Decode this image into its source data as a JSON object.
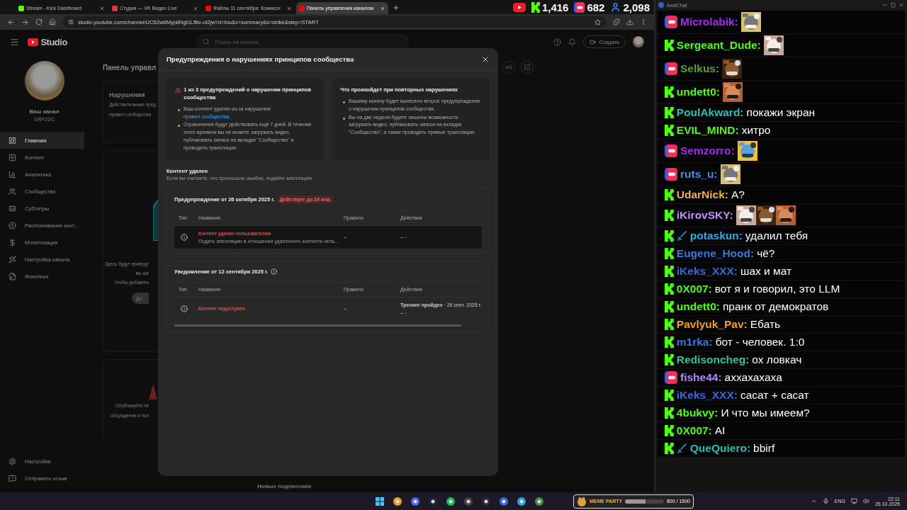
{
  "browser": {
    "tabs": [
      {
        "title": "Stream - Kick Dashboard",
        "kind": "kick",
        "selected": false
      },
      {
        "title": "Студия — VK Видео Live",
        "kind": "vk",
        "selected": false
      },
      {
        "title": "Файлы 11 сентября: Комиссн",
        "kind": "youtube",
        "selected": false
      },
      {
        "title": "Панель управления каналом",
        "kind": "youtube",
        "selected": true
      }
    ],
    "address": "studio.youtube.com/channel/UC5Zw6Myp8Ngt1LfBv-ot2jw?d=tou&v=summary&s=strike&step=START"
  },
  "stream_stats": [
    {
      "kind": "youtube"
    },
    {
      "kind": "kick",
      "count": "1,416"
    },
    {
      "kind": "live",
      "count": "682"
    },
    {
      "kind": "viewers",
      "count": "2,098"
    }
  ],
  "studio": {
    "logo": "Studio",
    "search_placeholder": "Поиск на канале",
    "create_button": "Создать",
    "channel": {
      "name": "Ваш канал",
      "handle": "GRPZDC"
    },
    "nav": [
      {
        "label": "Главная",
        "selected": true
      },
      {
        "label": "Контент",
        "selected": false
      },
      {
        "label": "Аналитика",
        "selected": false
      },
      {
        "label": "Сообщество",
        "selected": false
      },
      {
        "label": "Субтитры",
        "selected": false
      },
      {
        "label": "Распознавание конт...",
        "selected": false
      },
      {
        "label": "Монетизация",
        "selected": false
      },
      {
        "label": "Настройка канала",
        "selected": false
      },
      {
        "label": "Фонотека",
        "selected": false
      }
    ],
    "footer_nav": [
      "Настройки",
      "Отправить отзыв"
    ],
    "page_title": "Панель управл",
    "violations_card": {
      "title": "Нарушения",
      "lines": [
        "Действительные пред",
        "правил сообщества"
      ]
    },
    "uploads_card": {
      "lines": [
        "Здесь будут приведе",
        "вы заг",
        "Чтобы добавить"
      ],
      "button": "До"
    },
    "posts_card": {
      "lines": [
        "Опубликуйте пе",
        "обсуждение и пол"
      ]
    },
    "subscribers_title": "Новые подписчики"
  },
  "modal": {
    "title": "Предупреждения о нарушениях принципов сообщества",
    "strike_info": {
      "title": "1 из 3 предупреждений о нарушении принципов сообщества",
      "bullets": [
        {
          "text": "Ваш контент удален из-за нарушения",
          "link": "правил сообщества",
          "suffix": "."
        },
        {
          "text": "Ограничения будут действовать ещё 7 дней. В течение этого времени вы не можете загружать видео, публиковать записи на вкладке \"Сообщество\" и проводить трансляции."
        }
      ]
    },
    "repeat_info": {
      "title": "Что произойдет при повторных нарушениях",
      "bullets": [
        {
          "text": "Вашему каналу будет вынесено второе предупреждение о нарушении принципов сообщества."
        },
        {
          "text": "Вы на две недели будете лишены возможности загружать видео, публиковать записи на вкладке \"Сообщество\", а также проводить прямые трансляции."
        }
      ]
    },
    "removed": {
      "title": "Контент удален",
      "subtitle": "Если вы считаете, что произошла ошибка, подайте апелляцию."
    },
    "sections": [
      {
        "title": "Предупреждение от 26 октября 2025 г.",
        "tag": "Действует до 24 янв.",
        "info": false,
        "scrollbar": false,
        "columns": [
          "Тип",
          "Название",
          "Правило",
          "Действия"
        ],
        "rows": [
          {
            "name": "Контент удален пользователем",
            "note": "Подать апелляцию в отношении удаленного контента нель...",
            "rule": "–",
            "actions": [
              "– -"
            ],
            "hovered": true
          }
        ]
      },
      {
        "title": "Уведомление от 12 сентября 2025 г.",
        "info": true,
        "scrollbar": true,
        "columns": [
          "Тип",
          "Название",
          "Правило",
          "Действия"
        ],
        "rows": [
          {
            "name": "Контент недоступен",
            "rule": "–",
            "actions": [
              "**Тренинг пройден** · 29 сент. 2025 г.",
              "– -"
            ],
            "hovered": false
          }
        ]
      }
    ]
  },
  "chat": {
    "title": "AxelChat",
    "messages": [
      {
        "kind": "live",
        "name": "Microlabik:",
        "color": "#a02cf0"
      },
      {
        "kind": "kick",
        "name": "Sergeant_Dude:",
        "color": "#53fc18"
      },
      {
        "kind": "live",
        "name": "Selkus:",
        "color": "#5c9e3c"
      },
      {
        "kind": "kick",
        "name": "undett0:",
        "color": "#53fc18"
      },
      {
        "kind": "kick",
        "name": "PoulAkward:",
        "color": "#2cbfb0",
        "text": "покажи экран"
      },
      {
        "kind": "kick",
        "name": "EVIL_MIND:",
        "color": "#53fc18",
        "text": "хитро"
      },
      {
        "kind": "live",
        "name": "Semzorro:",
        "color": "#a02cf0"
      },
      {
        "kind": "live",
        "name": "ruts_u:",
        "color": "#4a8ee0"
      },
      {
        "kind": "kick",
        "name": "UdarNick:",
        "color": "#f0b050",
        "text": "А?"
      },
      {
        "kind": "kick",
        "name": "iKirovSKY:",
        "color": "#c090ff"
      },
      {
        "kind": "kick",
        "name": "potaskun:",
        "color": "#2aaee6",
        "badge": true,
        "text": "удалил тебя"
      },
      {
        "kind": "kick",
        "name": "Eugene_Hood:",
        "color": "#3a78d8",
        "text": "чё?"
      },
      {
        "kind": "kick",
        "name": "iKeks_XXX:",
        "color": "#3a68d8",
        "text": "шах и мат"
      },
      {
        "kind": "kick",
        "name": "0X007:",
        "color": "#53fc18",
        "text": "вот я и говорил, это LLM"
      },
      {
        "kind": "kick",
        "name": "undett0:",
        "color": "#53fc18",
        "text": "пранк от демократов"
      },
      {
        "kind": "kick",
        "name": "Pavlyuk_Pav:",
        "color": "#f0a020",
        "text": "Ебать"
      },
      {
        "kind": "kick",
        "name": "m1rka:",
        "color": "#3a78d8",
        "text": "бот - человек. 1:0"
      },
      {
        "kind": "kick",
        "name": "Redisoncheg:",
        "color": "#2cc59a",
        "text": "ох ловкач"
      },
      {
        "kind": "live",
        "name": "fishe44:",
        "color": "#b08cff",
        "text": "аххахахаха"
      },
      {
        "kind": "kick",
        "name": "iKeks_XXX:",
        "color": "#3a68d8",
        "text": "сасат + сасат"
      },
      {
        "kind": "kick",
        "name": "4bukvy:",
        "color": "#53fc18",
        "text": "И что мы имеем?"
      },
      {
        "kind": "kick",
        "name": "0X007:",
        "color": "#53fc18",
        "text": "AI"
      },
      {
        "kind": "kick",
        "name": "QueQuiero:",
        "color": "#2cbfb0",
        "badge": true,
        "text": "bbirf"
      }
    ]
  },
  "taskbar": {
    "widget": {
      "title": "MEME PARTY",
      "progress": "800 / 1500",
      "level": 0.53
    },
    "lang": "ENG",
    "time": "22:11",
    "date": "26.10.2025"
  }
}
